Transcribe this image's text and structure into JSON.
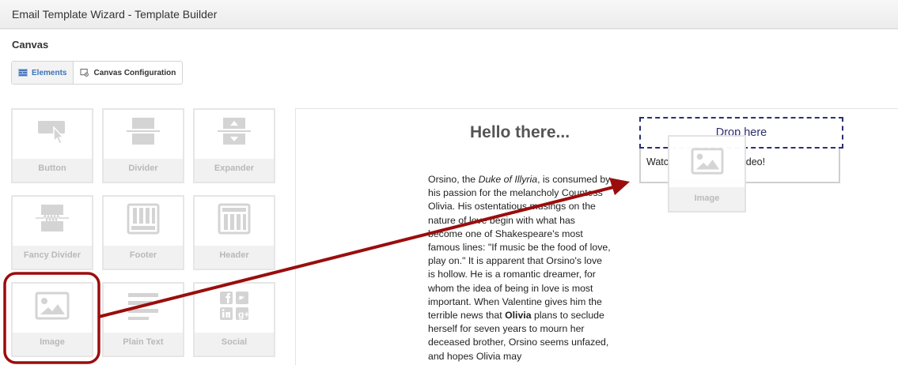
{
  "window": {
    "title": "Email Template Wizard - Template Builder"
  },
  "section": {
    "title": "Canvas"
  },
  "tabs": [
    {
      "label": "Elements",
      "icon": "elements-grid-icon",
      "active": true
    },
    {
      "label": "Canvas Configuration",
      "icon": "canvas-config-icon",
      "active": false
    }
  ],
  "palette": {
    "items": [
      {
        "label": "Button",
        "icon": "button-pointer-icon"
      },
      {
        "label": "Divider",
        "icon": "divider-icon"
      },
      {
        "label": "Expander",
        "icon": "expander-icon"
      },
      {
        "label": "Fancy Divider",
        "icon": "fancy-divider-icon"
      },
      {
        "label": "Footer",
        "icon": "footer-icon"
      },
      {
        "label": "Header",
        "icon": "header-icon"
      },
      {
        "label": "Image",
        "icon": "image-icon"
      },
      {
        "label": "Plain Text",
        "icon": "plain-text-icon"
      },
      {
        "label": "Social",
        "icon": "social-icon"
      }
    ]
  },
  "canvas": {
    "heading": "Hello there...",
    "body": {
      "p1": "Orsino, the ",
      "duke": "Duke of Illyria",
      "p2": ", is consumed by his passion for the melancholy Countess Olivia. His ostentatious musings on the nature of love begin with what has become one of Shakespeare's most famous lines: \"If music be the food of love, play on.\" It is apparent that Orsino's love is hollow. He is a romantic dreamer, for whom the idea of being in love is most important. When Valentine gives him the terrible news that ",
      "olivia": "Olivia",
      "p3": " plans to seclude herself for seven years to mourn her deceased brother, Orsino seems unfazed, and hopes Olivia may"
    },
    "watch_text": "Watc",
    "watch_text_end": "ideo!",
    "drop_zone_label": "Drop here",
    "drag_ghost_label": "Image"
  },
  "colors": {
    "accent": "#3b73b9",
    "annotation": "#9b0d0d",
    "drop_zone": "#2b2f6f"
  }
}
